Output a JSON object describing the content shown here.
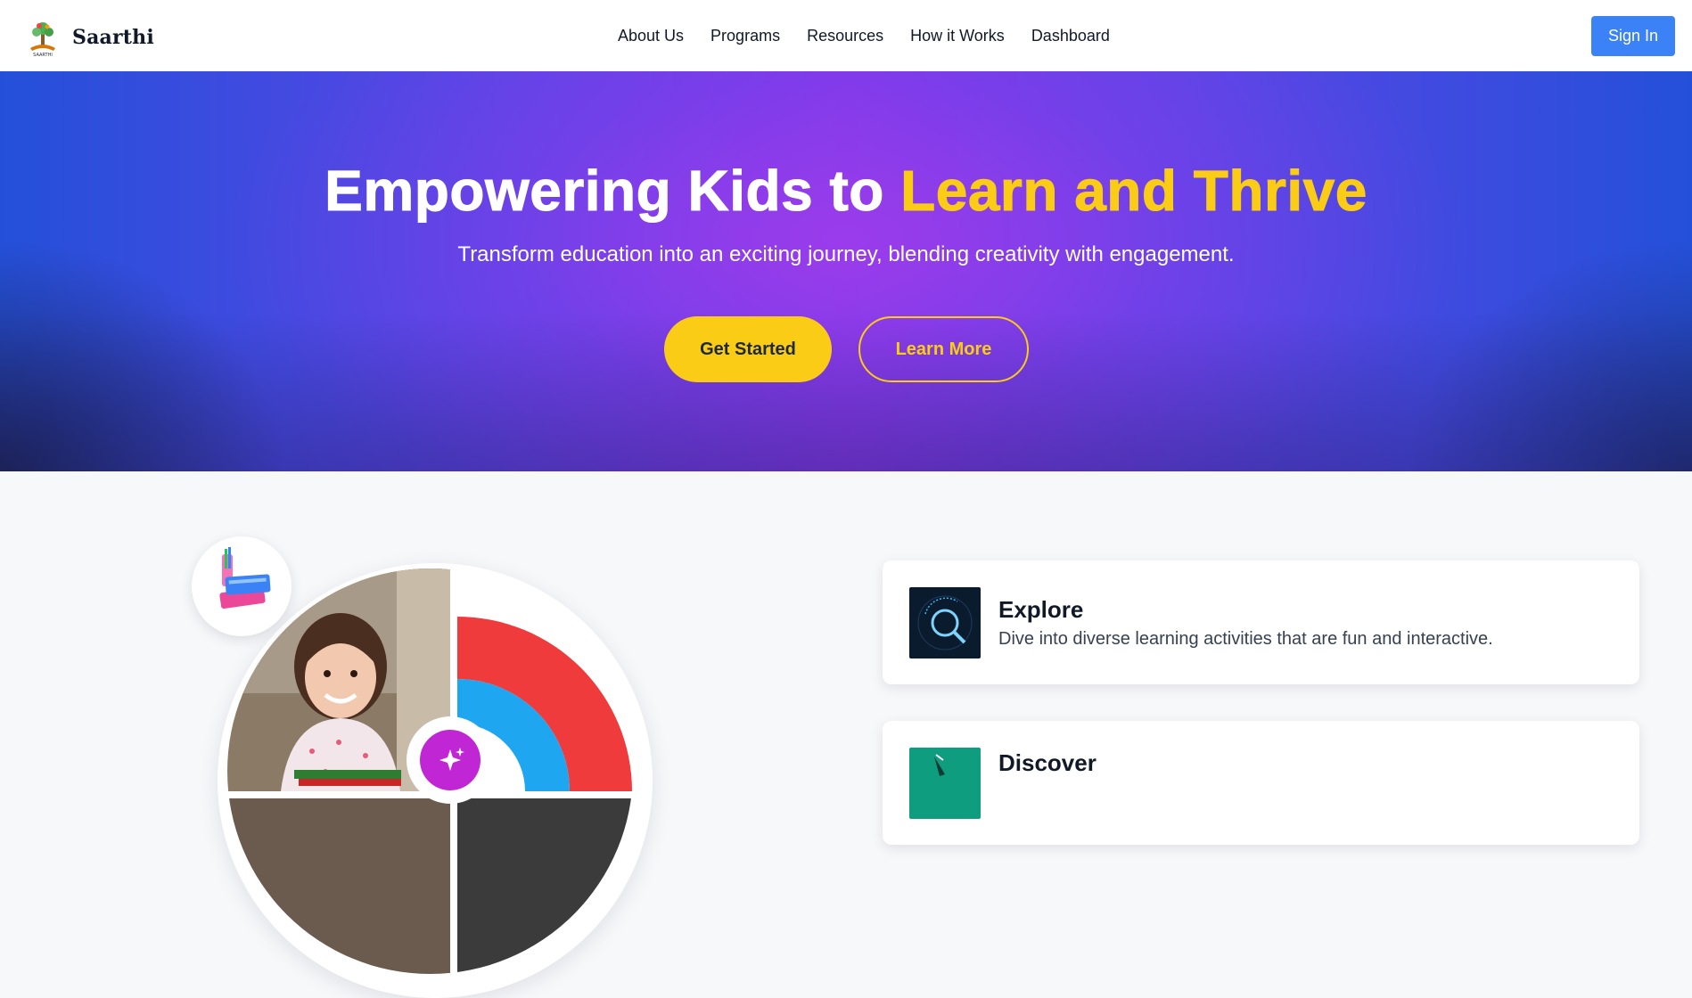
{
  "navbar": {
    "brand_name": "Saarthi",
    "logo_icon": "tree-logo-icon",
    "links": [
      "About Us",
      "Programs",
      "Resources",
      "How it Works",
      "Dashboard"
    ],
    "signin_label": "Sign In"
  },
  "hero": {
    "title_main": "Empowering Kids to ",
    "title_accent": "Learn and Thrive",
    "subtitle": "Transform education into an exciting journey, blending creativity with engagement.",
    "primary_button": "Get Started",
    "secondary_button": "Learn More"
  },
  "features": {
    "badge_icon": "books-icon",
    "spark_icon": "sparkle-icon",
    "cards": [
      {
        "icon": "magnifier-exploration-icon",
        "title": "Explore",
        "description": "Dive into diverse learning activities that are fun and interactive."
      },
      {
        "icon": "discover-thumbnail-icon",
        "title": "Discover",
        "description": ""
      }
    ]
  },
  "colors": {
    "accent_yellow": "#facc15",
    "primary_blue": "#3b82f6",
    "hero_purple": "#7c3aed",
    "chart_red": "#ef3b3b",
    "chart_blue": "#1ea7f0"
  }
}
